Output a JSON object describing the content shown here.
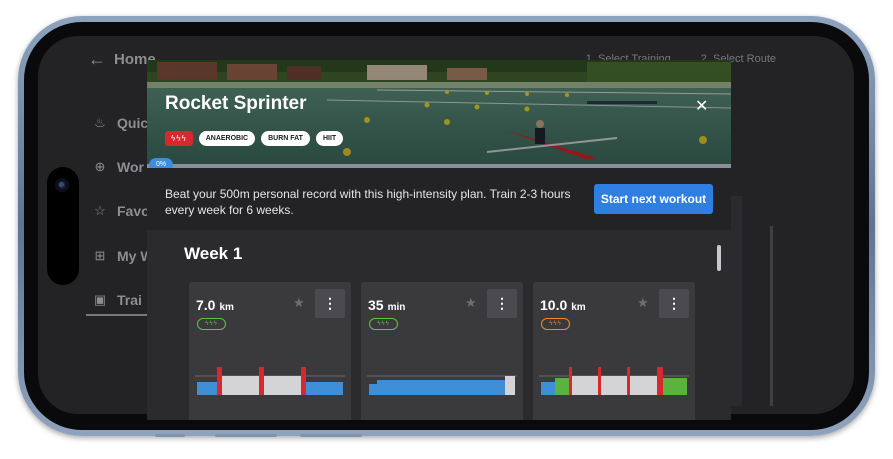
{
  "background_app": {
    "home_label": "Home",
    "steps": [
      "1. Select Training",
      "2. Select Route"
    ],
    "nav": [
      {
        "label": "Quic",
        "icon": "flame-icon"
      },
      {
        "label": "Wor",
        "icon": "dumbbell-icon"
      },
      {
        "label": "Favo",
        "icon": "star-icon"
      },
      {
        "label": "My W",
        "icon": "grid-icon"
      },
      {
        "label": "Trai",
        "icon": "calendar-icon"
      }
    ]
  },
  "modal": {
    "title": "Rocket Sprinter",
    "intensity": "ϟϟϟ",
    "tags": [
      "ANAEROBIC",
      "BURN FAT",
      "HIIT"
    ],
    "progress": "0%",
    "progress_value": 0,
    "description": "Beat your 500m personal record with this high-intensity plan. Train 2-3 hours every week for 6 weeks.",
    "cta_label": "Start next workout",
    "close_icon": "close-icon"
  },
  "week": {
    "title": "Week 1",
    "cards": [
      {
        "value": "7.0",
        "unit": "km",
        "intensity": "ϟϟϟ",
        "intensity_color": "#5fc24a"
      },
      {
        "value": "35",
        "unit": "min",
        "intensity": "ϟϟϟ",
        "intensity_color": "#5fc24a"
      },
      {
        "value": "10.0",
        "unit": "km",
        "intensity": "ϟϟϟ",
        "intensity_color": "#f08a24"
      }
    ]
  },
  "colors": {
    "accent": "#2f7fe2",
    "intensity_red": "#d6282d",
    "bar_blue": "#3e8fd6",
    "bar_gray": "#d4d4d6",
    "bar_red": "#d6282d",
    "bar_green": "#5bb33f"
  }
}
